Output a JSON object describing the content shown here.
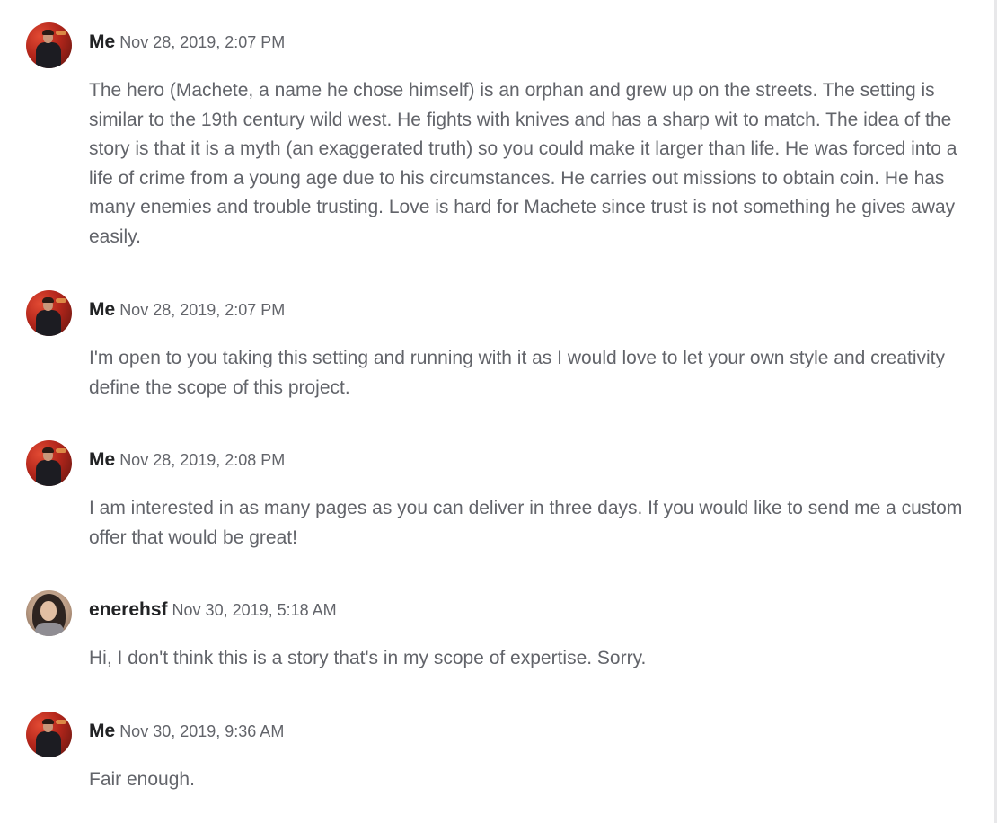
{
  "messages": [
    {
      "sender": "Me",
      "timestamp": "Nov 28, 2019, 2:07 PM",
      "avatar_icon": "user-avatar-photo",
      "text": "The hero (Machete, a name he chose himself) is an orphan and grew up on the streets. The setting is similar to the 19th century wild west. He fights with knives and has a sharp wit to match. The idea of the story is that it is a myth (an exaggerated truth) so you could make it larger than life. He was forced into a life of crime from a young age due to his circumstances. He carries out missions to obtain coin. He has many enemies and trouble trusting. Love is hard for Machete since trust is not something he gives away easily."
    },
    {
      "sender": "Me",
      "timestamp": "Nov 28, 2019, 2:07 PM",
      "avatar_icon": "user-avatar-photo",
      "text": "I'm open to you taking this setting and running with it as I would love to let your own style and creativity define the scope of this project."
    },
    {
      "sender": "Me",
      "timestamp": "Nov 28, 2019, 2:08 PM",
      "avatar_icon": "user-avatar-photo",
      "text": "I am interested in as many pages as you can deliver in three days. If you would like to send me a custom offer that would be great!"
    },
    {
      "sender": "enerehsf",
      "timestamp": "Nov 30, 2019, 5:18 AM",
      "avatar_icon": "user-avatar-photo",
      "text": "Hi, I don't think this is a story that's in my scope of expertise. Sorry."
    },
    {
      "sender": "Me",
      "timestamp": "Nov 30, 2019, 9:36 AM",
      "avatar_icon": "user-avatar-photo",
      "text": "Fair enough."
    }
  ],
  "colors": {
    "sender_name": "#222325",
    "body_text": "#62646a",
    "background": "#ffffff"
  }
}
